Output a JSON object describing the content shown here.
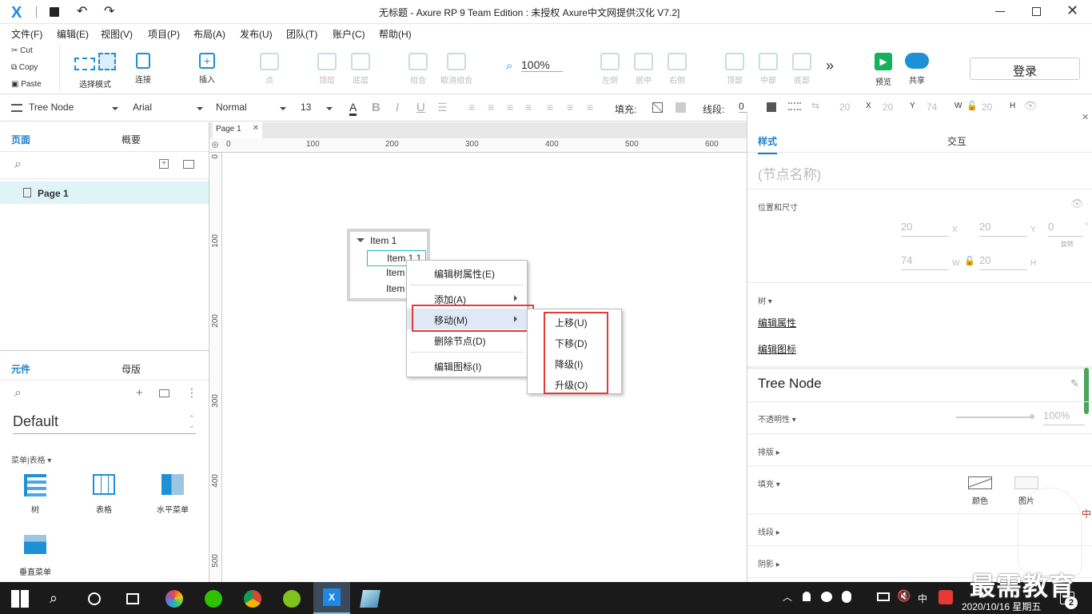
{
  "titlebar": {
    "title": "无标题 - Axure RP 9 Team Edition : 未授权    Axure中文网提供汉化 V7.2]",
    "logo": "X"
  },
  "menu": [
    "文件(F)",
    "编辑(E)",
    "视图(V)",
    "项目(P)",
    "布局(A)",
    "发布(U)",
    "团队(T)",
    "账户(C)",
    "帮助(H)"
  ],
  "clipboard": {
    "cut": "Cut",
    "copy": "Copy",
    "paste": "Paste"
  },
  "toolbar": {
    "select_mode": "选择模式",
    "connect": "连接",
    "insert": "插入",
    "point": "点",
    "top": "顶层",
    "bottom": "底层",
    "group": "组合",
    "ungroup": "取消组合",
    "zoom": "100%",
    "left": "左侧",
    "center": "居中",
    "right": "右侧",
    "align_top": "顶部",
    "middle": "中部",
    "align_bottom": "底部",
    "more": "»",
    "preview": "预览",
    "share": "共享",
    "login": "登录"
  },
  "format": {
    "style": "Tree Node",
    "font": "Arial",
    "weight": "Normal",
    "size": "13",
    "fill_label": "填充:",
    "line_label": "线段:",
    "line_value": "0",
    "x_label": "X",
    "x_value": "20",
    "y_label": "Y",
    "y_value": "20",
    "w_label": "W",
    "w_value": "74",
    "h_label": "H",
    "h_value": "20",
    "extra1": "20",
    "extra2": "20"
  },
  "left_panel": {
    "tab_pages": "页面",
    "tab_outline": "概要",
    "page_item": "Page 1",
    "tab_widgets": "元件",
    "tab_masters": "母版",
    "library": "Default",
    "category": "菜单|表格 ▾",
    "widgets": [
      "树",
      "表格",
      "水平菜单",
      "垂直菜单"
    ]
  },
  "canvas": {
    "tab": "Page 1",
    "ruler_h": [
      "0",
      "100",
      "200",
      "300",
      "400",
      "500",
      "600"
    ],
    "ruler_v": [
      "0",
      "100",
      "200",
      "300",
      "400",
      "500"
    ],
    "tree": {
      "root": "Item 1",
      "child1": "Item 1.1",
      "child2": "Item",
      "child3": "Item"
    }
  },
  "context_menu": {
    "items": [
      "编辑树属性(E)",
      "添加(A)",
      "移动(M)",
      "删除节点(D)",
      "编辑图标(I)"
    ],
    "submenu": [
      "上移(U)",
      "下移(D)",
      "降级(I)",
      "升级(O)"
    ]
  },
  "right_panel": {
    "tab_style": "样式",
    "tab_interaction": "交互",
    "node_name_placeholder": "(节点名称)",
    "pos_size": "位置和尺寸",
    "x": "20",
    "x_unit": "X",
    "y": "20",
    "y_unit": "Y",
    "rot": "0",
    "rot_unit": "°",
    "rot_label": "旋转",
    "w": "74",
    "w_unit": "W",
    "h": "20",
    "h_unit": "H",
    "tree_label": "树 ▾",
    "edit_props": "编辑属性",
    "edit_icon": "编辑图标",
    "style_name": "Tree Node",
    "opacity": "不透明性 ▾",
    "opacity_value": "100%",
    "typography": "排版 ▸",
    "fill": "填充 ▾",
    "fill_color": "颜色",
    "fill_image": "图片",
    "line": "线段 ▸",
    "shadow": "阴影 ▸"
  },
  "taskbar": {
    "datetime": "2020/10/16 星期五",
    "ime": "中",
    "badge": "2"
  },
  "watermark": {
    "text": "最需教育"
  }
}
